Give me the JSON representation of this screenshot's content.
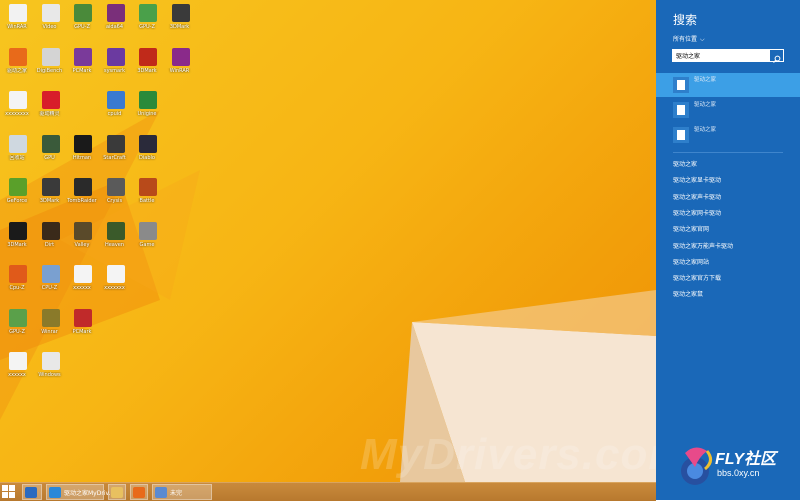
{
  "desktop": {
    "watermark": "MyDrivers.com",
    "icons": [
      {
        "label": "WinRAR",
        "c": "#f2f2f2",
        "col": 0,
        "row": 0
      },
      {
        "label": "Video",
        "c": "#e8e8e8",
        "col": 1,
        "row": 0
      },
      {
        "label": "GPU-Z",
        "c": "#4a8a3a",
        "col": 2,
        "row": 0
      },
      {
        "label": "aida64",
        "c": "#7a2f7a",
        "col": 3,
        "row": 0
      },
      {
        "label": "GPU-Z",
        "c": "#4aa04a",
        "col": 4,
        "row": 0
      },
      {
        "label": "3DMark",
        "c": "#3a3a3a",
        "col": 5,
        "row": 0
      },
      {
        "label": "驱动之家",
        "c": "#e86a1a",
        "col": 0,
        "row": 1
      },
      {
        "label": "DigiBench",
        "c": "#d4d4d4",
        "col": 1,
        "row": 1
      },
      {
        "label": "PCMark",
        "c": "#7a3a9a",
        "col": 2,
        "row": 1
      },
      {
        "label": "sysmark",
        "c": "#6b3aa0",
        "col": 3,
        "row": 1
      },
      {
        "label": "3DMark",
        "c": "#c02a1a",
        "col": 4,
        "row": 1
      },
      {
        "label": "WinRAR",
        "c": "#8a2a8a",
        "col": 5,
        "row": 1
      },
      {
        "label": "xxxxxxxx",
        "c": "#f4f4f4",
        "col": 0,
        "row": 2
      },
      {
        "label": "驱动精灵",
        "c": "#d81e2a",
        "col": 1,
        "row": 2
      },
      {
        "label": "cpuid",
        "c": "#3a7ad0",
        "col": 3,
        "row": 2
      },
      {
        "label": "Unigine",
        "c": "#2a8a3a",
        "col": 4,
        "row": 2
      },
      {
        "label": "回收站",
        "c": "#cfd8e0",
        "col": 0,
        "row": 3
      },
      {
        "label": "GPU",
        "c": "#3a5a3a",
        "col": 1,
        "row": 3
      },
      {
        "label": "Hitman",
        "c": "#1a1a1a",
        "col": 2,
        "row": 3
      },
      {
        "label": "StarCraft",
        "c": "#3a3a3a",
        "col": 3,
        "row": 3
      },
      {
        "label": "Diablo",
        "c": "#2a2a3a",
        "col": 4,
        "row": 3
      },
      {
        "label": "GeForce",
        "c": "#5aa02a",
        "col": 0,
        "row": 4
      },
      {
        "label": "3DMark",
        "c": "#3a3a3a",
        "col": 1,
        "row": 4
      },
      {
        "label": "TombRaider",
        "c": "#2a2a2a",
        "col": 2,
        "row": 4
      },
      {
        "label": "Crysis",
        "c": "#5a5a5a",
        "col": 3,
        "row": 4
      },
      {
        "label": "Battle",
        "c": "#b84a1a",
        "col": 4,
        "row": 4
      },
      {
        "label": "3DMark",
        "c": "#1a1a1a",
        "col": 0,
        "row": 5
      },
      {
        "label": "Dirt",
        "c": "#3a2a1a",
        "col": 1,
        "row": 5
      },
      {
        "label": "Valley",
        "c": "#5a4a2a",
        "col": 2,
        "row": 5
      },
      {
        "label": "Heaven",
        "c": "#3a5a2a",
        "col": 3,
        "row": 5
      },
      {
        "label": "Game",
        "c": "#8a8a8a",
        "col": 4,
        "row": 5
      },
      {
        "label": "Cpu-Z",
        "c": "#e05a1a",
        "col": 0,
        "row": 6
      },
      {
        "label": "CPU-Z",
        "c": "#7aa0d0",
        "col": 1,
        "row": 6
      },
      {
        "label": "xxxxxx",
        "c": "#f4f4f4",
        "col": 2,
        "row": 6
      },
      {
        "label": "xxxxxxx",
        "c": "#f4f4f4",
        "col": 3,
        "row": 6
      },
      {
        "label": "GPU-Z",
        "c": "#5aa04a",
        "col": 0,
        "row": 7
      },
      {
        "label": "Winrar",
        "c": "#8a7a2a",
        "col": 1,
        "row": 7
      },
      {
        "label": "PCMark",
        "c": "#c02a2a",
        "col": 2,
        "row": 7
      },
      {
        "label": "xxxxxx",
        "c": "#f4f4f4",
        "col": 0,
        "row": 8
      },
      {
        "label": "Windows",
        "c": "#e8e8e8",
        "col": 1,
        "row": 8
      }
    ]
  },
  "taskbar": {
    "items": [
      {
        "label": "",
        "c": "#2a6ac0",
        "w": 20
      },
      {
        "label": "驱动之家MyDriv...",
        "c": "#2a88d8",
        "w": 58
      },
      {
        "label": "",
        "c": "#e8c060",
        "w": 18
      },
      {
        "label": "",
        "c": "#e86a1a",
        "w": 18
      },
      {
        "label": "未完",
        "c": "#5a8ad0",
        "w": 60
      }
    ]
  },
  "charm": {
    "title": "搜索",
    "scope": "所有位置",
    "query": "驱动之家",
    "files": [
      {
        "name": "驱动之家",
        "selected": true
      },
      {
        "name": "驱动之家",
        "selected": false
      },
      {
        "name": "驱动之家",
        "selected": false
      }
    ],
    "suggestions": [
      "驱动之家",
      "驱动之家显卡驱动",
      "驱动之家声卡驱动",
      "驱动之家网卡驱动",
      "驱动之家官网",
      "驱动之家万能声卡驱动",
      "驱动之家网站",
      "驱动之家官方下载",
      "驱动之家鼠"
    ]
  },
  "brand": {
    "name": "FLY社区",
    "url": "bbs.0xy.cn"
  },
  "colors": {
    "charm_bg": "#1a68b8",
    "selected": "#3c9fe6",
    "desktop": "#f7b514"
  }
}
